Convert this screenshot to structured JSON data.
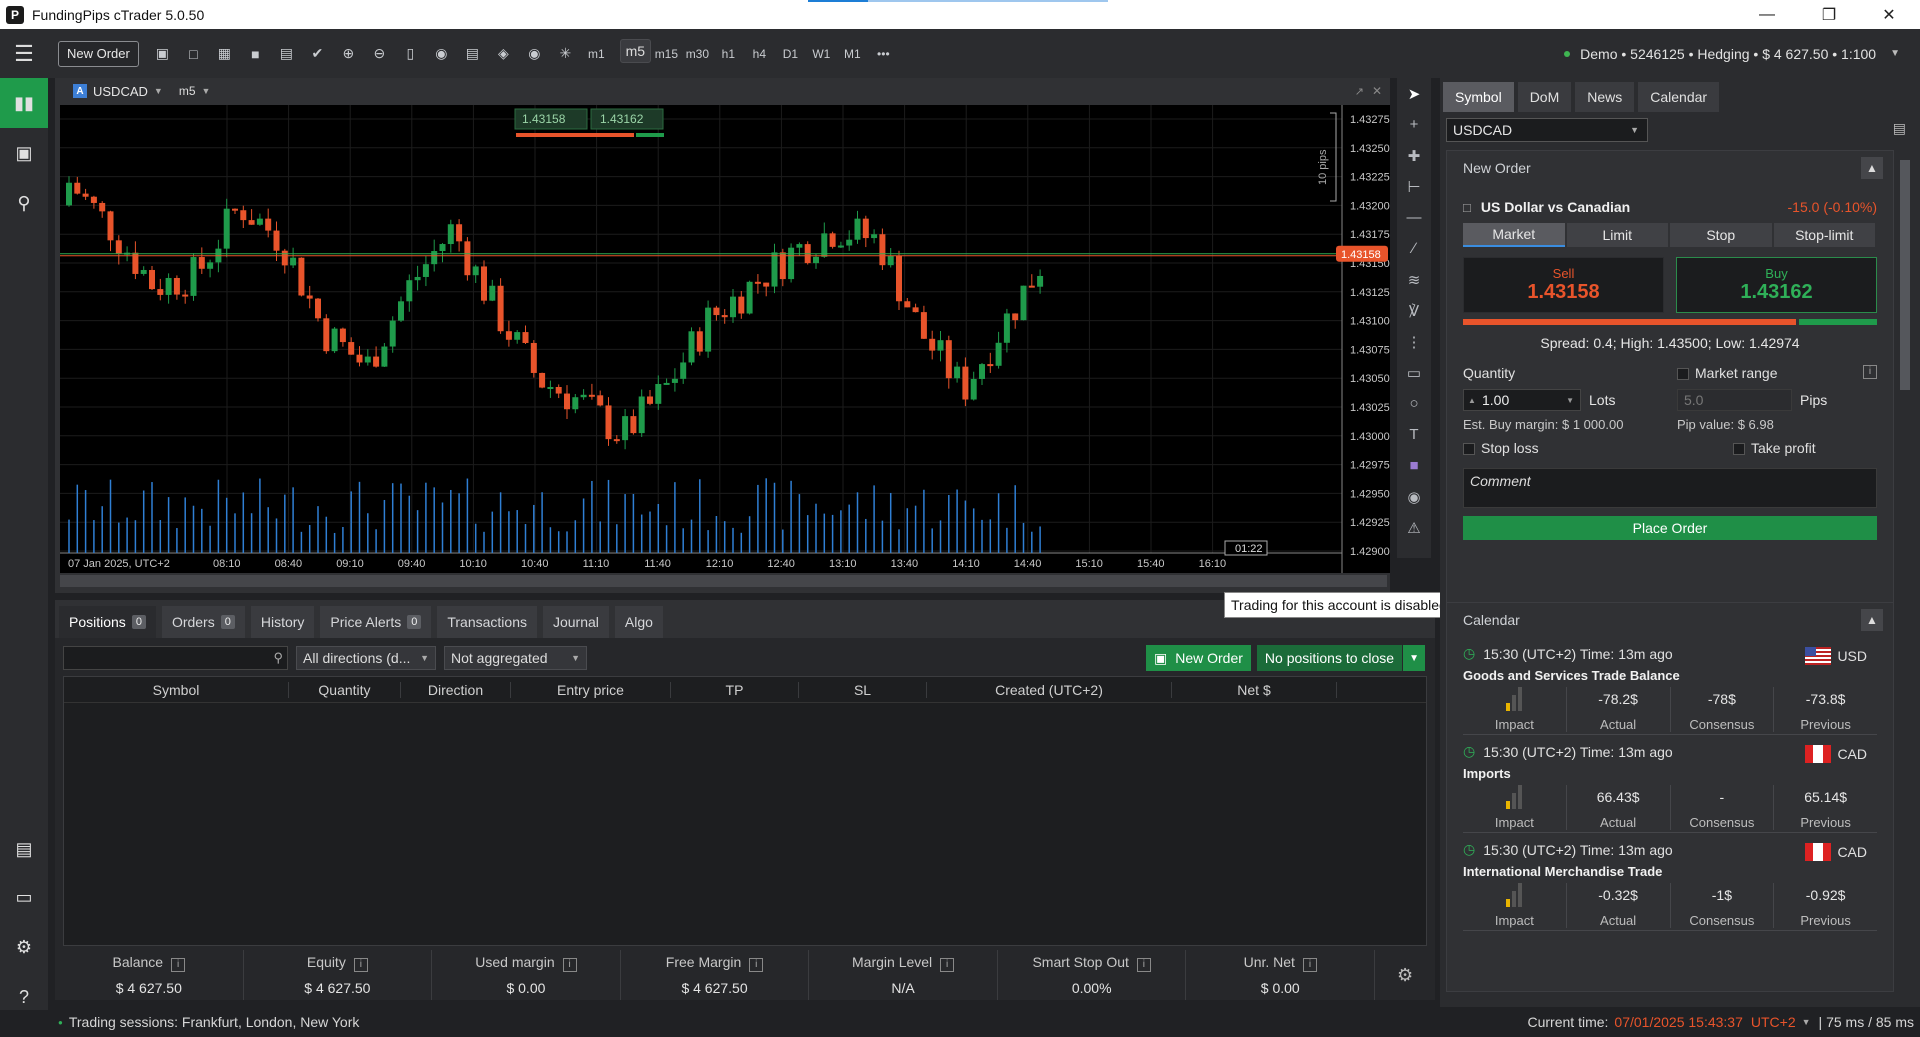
{
  "app": {
    "title": "FundingPips cTrader 5.0.50"
  },
  "toolbar": {
    "new_order": "New Order",
    "timeframes": [
      "m1",
      "m5",
      "m15",
      "m30",
      "h1",
      "h4",
      "D1",
      "W1",
      "M1"
    ],
    "selected_timeframe": "m5",
    "more": "•••",
    "account": "Demo • 5246125 • Hedging • $ 4 627.50 • 1:100"
  },
  "chart": {
    "symbol_badge": "A",
    "symbol": "USDCAD",
    "timeframe": "m5",
    "sell_quote": "1.43158",
    "buy_quote": "1.43162",
    "pips_label": "10 pips",
    "current_price_label": "1.43158",
    "countdown": "01:22",
    "price_axis": [
      "1.43275",
      "1.43250",
      "1.43225",
      "1.43200",
      "1.43175",
      "1.43150",
      "1.43125",
      "1.43100",
      "1.43075",
      "1.43050",
      "1.43025",
      "1.43000",
      "1.42975",
      "1.42950",
      "1.42925",
      "1.42900"
    ],
    "time_axis": [
      "07 Jan 2025, UTC+2",
      "08:10",
      "08:40",
      "09:10",
      "09:40",
      "10:10",
      "10:40",
      "11:10",
      "11:40",
      "12:10",
      "12:40",
      "13:10",
      "13:40",
      "14:10",
      "14:40",
      "15:10",
      "15:40",
      "16:10"
    ],
    "up_color": "#1f9b4b",
    "down_color": "#e8542b",
    "volume_color": "#2f7fd4"
  },
  "bottom": {
    "tabs": [
      {
        "label": "Positions",
        "count": "0"
      },
      {
        "label": "Orders",
        "count": "0"
      },
      {
        "label": "History"
      },
      {
        "label": "Price Alerts",
        "count": "0"
      },
      {
        "label": "Transactions"
      },
      {
        "label": "Journal"
      },
      {
        "label": "Algo"
      }
    ],
    "direction_filter": "All directions (d...",
    "aggregation_filter": "Not aggregated",
    "new_order": "New Order",
    "close_all": "No positions to close",
    "columns": [
      "Symbol",
      "Quantity",
      "Direction",
      "Entry price",
      "TP",
      "SL",
      "Created (UTC+2)",
      "Net $"
    ],
    "summary": [
      {
        "label": "Balance",
        "value": "$ 4 627.50"
      },
      {
        "label": "Equity",
        "value": "$ 4 627.50"
      },
      {
        "label": "Used margin",
        "value": "$ 0.00"
      },
      {
        "label": "Free Margin",
        "value": "$ 4 627.50"
      },
      {
        "label": "Margin Level",
        "value": "N/A"
      },
      {
        "label": "Smart Stop Out",
        "value": "0.00%"
      },
      {
        "label": "Unr. Net",
        "value": "$ 0.00"
      }
    ]
  },
  "tooltip": "Trading for this account is disabled",
  "right": {
    "tabs": [
      "Symbol",
      "DoM",
      "News",
      "Calendar"
    ],
    "symbol_select": "USDCAD",
    "new_order": {
      "title": "New Order",
      "instrument": "US Dollar vs Canadian",
      "change": "-15.0 (-0.10%)",
      "order_types": [
        "Market",
        "Limit",
        "Stop",
        "Stop-limit"
      ],
      "sell_label": "Sell",
      "sell_price": "1.43158",
      "buy_label": "Buy",
      "buy_price": "1.43162",
      "spread_info": "Spread: 0.4; High: 1.43500; Low: 1.42974",
      "quantity_label": "Quantity",
      "quantity_value": "1.00",
      "lots": "Lots",
      "market_range": "Market range",
      "range_value": "5.0",
      "pips": "Pips",
      "est_margin": "Est. Buy margin: $ 1 000.00",
      "pip_value": "Pip value: $ 6.98",
      "stop_loss": "Stop loss",
      "take_profit": "Take profit",
      "comment_placeholder": "Comment",
      "place_order": "Place Order"
    },
    "calendar": {
      "title": "Calendar",
      "events": [
        {
          "time": "15:30 (UTC+2) Time:  13m ago",
          "title": "Goods and Services Trade Balance",
          "currency": "USD",
          "actual": "-78.2$",
          "consensus": "-78$",
          "previous": "-73.8$"
        },
        {
          "time": "15:30 (UTC+2) Time:  13m ago",
          "title": "Imports",
          "currency": "CAD",
          "actual": "66.43$",
          "consensus": "-",
          "previous": "65.14$"
        },
        {
          "time": "15:30 (UTC+2) Time:  13m ago",
          "title": "International Merchandise Trade",
          "currency": "CAD",
          "actual": "-0.32$",
          "consensus": "-1$",
          "previous": "-0.92$"
        }
      ],
      "labels": {
        "impact": "Impact",
        "actual": "Actual",
        "consensus": "Consensus",
        "previous": "Previous"
      }
    }
  },
  "status": {
    "sessions": "Trading sessions: Frankfurt, London, New York",
    "current_time_label": "Current time:",
    "current_time": "07/01/2025 15:43:37",
    "tz": "UTC+2",
    "latency": "| 75 ms / 85 ms"
  }
}
